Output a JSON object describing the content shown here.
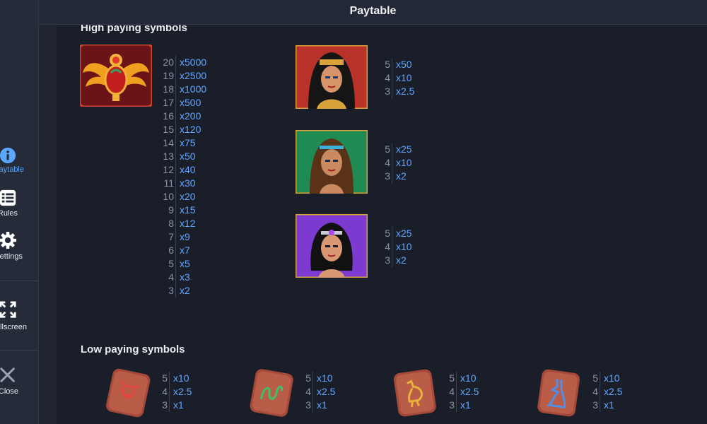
{
  "header": {
    "title": "Paytable"
  },
  "sidebar": {
    "items": [
      {
        "label": "Paytable",
        "icon": "info-icon"
      },
      {
        "label": "Rules",
        "icon": "list-icon"
      },
      {
        "label": "Settings",
        "icon": "gear-icon"
      },
      {
        "label": "Fullscreen",
        "icon": "fullscreen-icon"
      },
      {
        "label": "Close",
        "icon": "close-icon"
      }
    ]
  },
  "high": {
    "title": "High paying symbols",
    "symbols": [
      {
        "name": "Golden scarab",
        "pays": [
          {
            "count": "20",
            "value": "x5000"
          },
          {
            "count": "19",
            "value": "x2500"
          },
          {
            "count": "18",
            "value": "x1000"
          },
          {
            "count": "17",
            "value": "x500"
          },
          {
            "count": "16",
            "value": "x200"
          },
          {
            "count": "15",
            "value": "x120"
          },
          {
            "count": "14",
            "value": "x75"
          },
          {
            "count": "13",
            "value": "x50"
          },
          {
            "count": "12",
            "value": "x40"
          },
          {
            "count": "11",
            "value": "x30"
          },
          {
            "count": "10",
            "value": "x20"
          },
          {
            "count": "9",
            "value": "x15"
          },
          {
            "count": "8",
            "value": "x12"
          },
          {
            "count": "7",
            "value": "x9"
          },
          {
            "count": "6",
            "value": "x7"
          },
          {
            "count": "5",
            "value": "x5"
          },
          {
            "count": "4",
            "value": "x3"
          },
          {
            "count": "3",
            "value": "x2"
          }
        ]
      },
      {
        "name": "Cleopatra (red)",
        "pays": [
          {
            "count": "5",
            "value": "x50"
          },
          {
            "count": "4",
            "value": "x10"
          },
          {
            "count": "3",
            "value": "x2.5"
          }
        ]
      },
      {
        "name": "Egyptian woman (green)",
        "pays": [
          {
            "count": "5",
            "value": "x25"
          },
          {
            "count": "4",
            "value": "x10"
          },
          {
            "count": "3",
            "value": "x2"
          }
        ]
      },
      {
        "name": "Egyptian woman (purple)",
        "pays": [
          {
            "count": "5",
            "value": "x25"
          },
          {
            "count": "4",
            "value": "x10"
          },
          {
            "count": "3",
            "value": "x2"
          }
        ]
      }
    ]
  },
  "low": {
    "title": "Low paying symbols",
    "symbols": [
      {
        "name": "Red bull glyph stone",
        "glyph_color": "#e0473f",
        "pays": [
          {
            "count": "5",
            "value": "x10"
          },
          {
            "count": "4",
            "value": "x2.5"
          },
          {
            "count": "3",
            "value": "x1"
          }
        ]
      },
      {
        "name": "Green snake glyph stone",
        "glyph_color": "#3fbf6a",
        "pays": [
          {
            "count": "5",
            "value": "x10"
          },
          {
            "count": "4",
            "value": "x2.5"
          },
          {
            "count": "3",
            "value": "x1"
          }
        ]
      },
      {
        "name": "Gold ibis glyph stone",
        "glyph_color": "#e7b23a",
        "pays": [
          {
            "count": "5",
            "value": "x10"
          },
          {
            "count": "4",
            "value": "x2.5"
          },
          {
            "count": "3",
            "value": "x1"
          }
        ]
      },
      {
        "name": "Blue jackal glyph stone",
        "glyph_color": "#4f8fe8",
        "pays": [
          {
            "count": "5",
            "value": "x10"
          },
          {
            "count": "4",
            "value": "x2.5"
          },
          {
            "count": "3",
            "value": "x1"
          }
        ]
      }
    ]
  },
  "colors": {
    "accent": "#5aa8ff",
    "pay_value": "#63a6ff",
    "background": "#1a1e28"
  }
}
